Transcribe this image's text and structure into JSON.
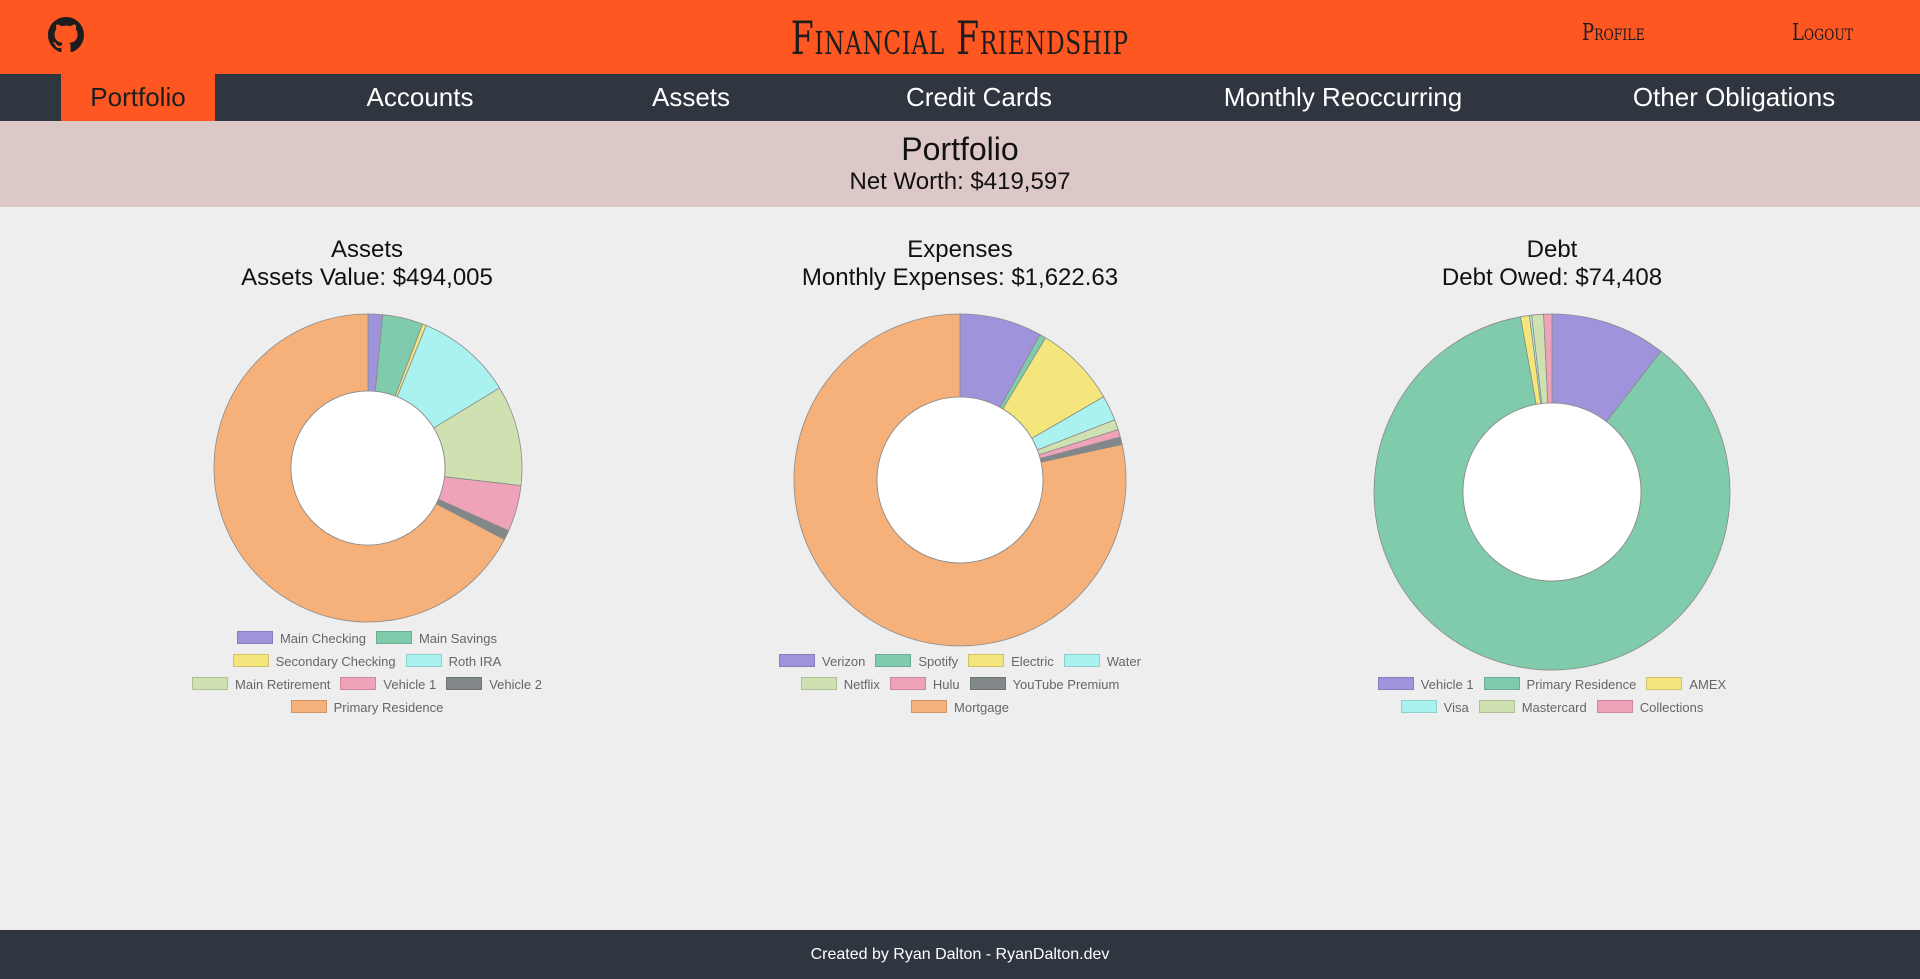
{
  "header": {
    "brand": "Financial Friendship",
    "profile_label": "Profile",
    "logout_label": "Logout",
    "github_icon": "github-icon"
  },
  "nav": {
    "items": [
      {
        "label": "Portfolio",
        "active": true
      },
      {
        "label": "Accounts",
        "active": false
      },
      {
        "label": "Assets",
        "active": false
      },
      {
        "label": "Credit Cards",
        "active": false
      },
      {
        "label": "Monthly Reoccurring",
        "active": false
      },
      {
        "label": "Other Obligations",
        "active": false
      }
    ]
  },
  "banner": {
    "title": "Portfolio",
    "subtitle": "Net Worth: $419,597"
  },
  "colors": {
    "brand": "#ff5722",
    "nav_bg": "#2f363f",
    "banner_bg": "#dcc8c6"
  },
  "chart_data": [
    {
      "type": "pie",
      "title": "Assets",
      "subtitle": "Assets Value: $494,005",
      "legend_position": "bottom",
      "labels": [
        "Main Checking",
        "Main Savings",
        "Secondary Checking",
        "Roth IRA",
        "Main Retirement",
        "Vehicle 1",
        "Vehicle 2",
        "Primary Residence"
      ],
      "values": [
        7500,
        21000,
        2000,
        50000,
        52000,
        24000,
        5000,
        332505
      ],
      "colors": [
        "#9f94dc",
        "#80cbac",
        "#f4e67c",
        "#aaf2ef",
        "#cfe1b0",
        "#efa3b8",
        "#828889",
        "#f6b17a"
      ]
    },
    {
      "type": "pie",
      "title": "Expenses",
      "subtitle": "Monthly Expenses: $1,622.63",
      "legend_position": "bottom",
      "labels": [
        "Verizon",
        "Spotify",
        "Electric",
        "Water",
        "Netflix",
        "Hulu",
        "YouTube Premium",
        "Mortgage"
      ],
      "values": [
        130,
        10,
        130,
        40,
        16,
        12,
        12,
        1272.63
      ],
      "colors": [
        "#9f94dc",
        "#80cbac",
        "#f4e67c",
        "#aaf2ef",
        "#cfe1b0",
        "#efa3b8",
        "#828889",
        "#f6b17a"
      ]
    },
    {
      "type": "pie",
      "title": "Debt",
      "subtitle": "Debt Owed: $74,408",
      "legend_position": "bottom",
      "labels": [
        "Vehicle 1",
        "Primary Residence",
        "AMEX",
        "Visa",
        "Mastercard",
        "Collections"
      ],
      "values": [
        7800,
        64500,
        600,
        150,
        800,
        558
      ],
      "colors": [
        "#9f94dc",
        "#80cbac",
        "#f4e67c",
        "#aaf2ef",
        "#cfe1b0",
        "#efa3b8"
      ]
    }
  ],
  "footer": {
    "text": "Created by Ryan Dalton - RyanDalton.dev"
  }
}
